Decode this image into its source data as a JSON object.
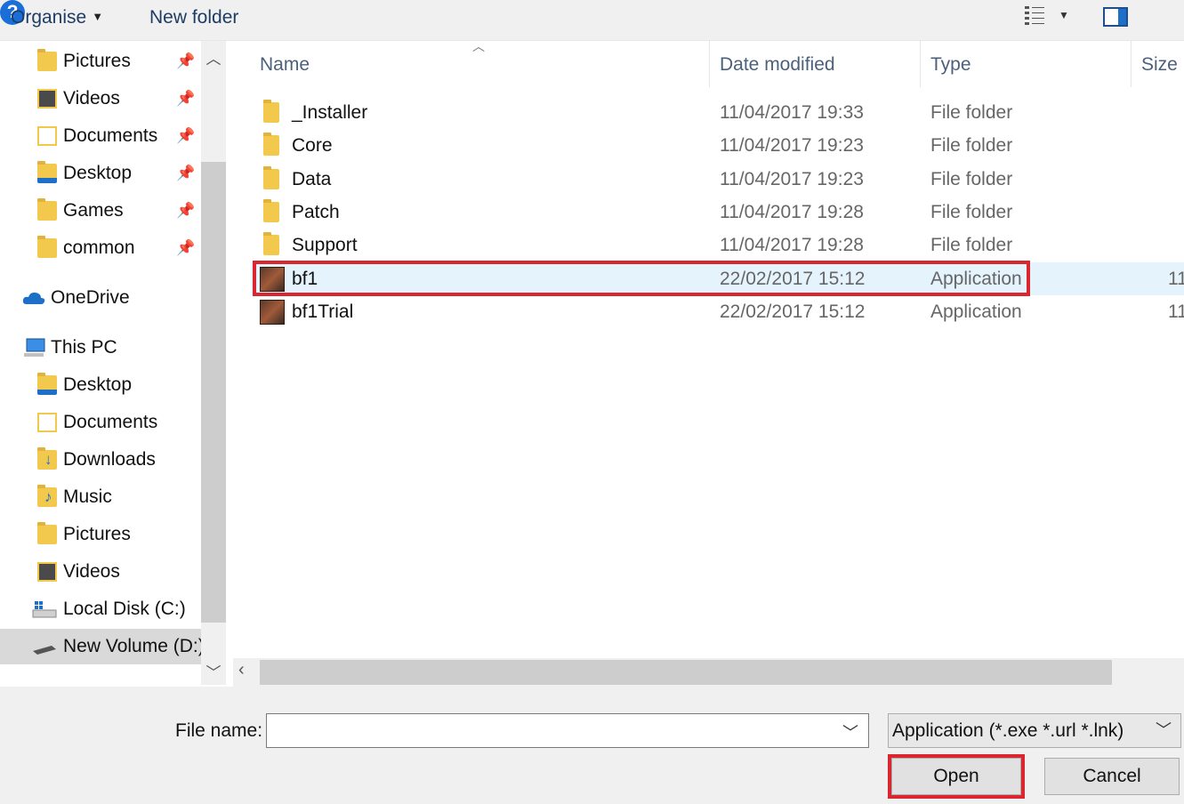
{
  "toolbar": {
    "organise_label": "Organise",
    "new_folder_label": "New folder",
    "help_label": "?"
  },
  "nav": {
    "quick_access": [
      {
        "label": "Pictures",
        "icon": "pictures-folder-icon",
        "pinned": true
      },
      {
        "label": "Videos",
        "icon": "videos-folder-icon",
        "pinned": true
      },
      {
        "label": "Documents",
        "icon": "documents-folder-icon",
        "pinned": true
      },
      {
        "label": "Desktop",
        "icon": "desktop-folder-icon",
        "pinned": true
      },
      {
        "label": "Games",
        "icon": "folder-icon",
        "pinned": true
      },
      {
        "label": "common",
        "icon": "folder-icon",
        "pinned": true
      }
    ],
    "onedrive_label": "OneDrive",
    "this_pc_label": "This PC",
    "this_pc_items": [
      {
        "label": "Desktop",
        "icon": "desktop-folder-icon"
      },
      {
        "label": "Documents",
        "icon": "documents-folder-icon"
      },
      {
        "label": "Downloads",
        "icon": "downloads-folder-icon"
      },
      {
        "label": "Music",
        "icon": "music-folder-icon"
      },
      {
        "label": "Pictures",
        "icon": "pictures-folder-icon"
      },
      {
        "label": "Videos",
        "icon": "videos-folder-icon"
      },
      {
        "label": "Local Disk (C:)",
        "icon": "local-disk-icon"
      },
      {
        "label": "New Volume (D:)",
        "icon": "drive-icon",
        "selected": true
      }
    ]
  },
  "list": {
    "columns": {
      "name": "Name",
      "date": "Date modified",
      "type": "Type",
      "size": "Size"
    },
    "rows": [
      {
        "name": "_Installer",
        "date": "11/04/2017 19:33",
        "type": "File folder",
        "size": "",
        "icon": "folder-icon"
      },
      {
        "name": "Core",
        "date": "11/04/2017 19:23",
        "type": "File folder",
        "size": "",
        "icon": "folder-icon"
      },
      {
        "name": "Data",
        "date": "11/04/2017 19:23",
        "type": "File folder",
        "size": "",
        "icon": "folder-icon"
      },
      {
        "name": "Patch",
        "date": "11/04/2017 19:28",
        "type": "File folder",
        "size": "",
        "icon": "folder-icon"
      },
      {
        "name": "Support",
        "date": "11/04/2017 19:28",
        "type": "File folder",
        "size": "",
        "icon": "folder-icon"
      },
      {
        "name": "bf1",
        "date": "22/02/2017 15:12",
        "type": "Application",
        "size": "11",
        "icon": "application-icon",
        "selected": true
      },
      {
        "name": "bf1Trial",
        "date": "22/02/2017 15:12",
        "type": "Application",
        "size": "11",
        "icon": "application-icon"
      }
    ]
  },
  "footer": {
    "file_name_label": "File name:",
    "file_name_value": "",
    "file_type_value": "Application (*.exe *.url *.lnk)",
    "open_label": "Open",
    "cancel_label": "Cancel"
  },
  "colors": {
    "highlight": "#d9262f",
    "selection": "#e5f3fd",
    "folder": "#f2c94c",
    "accent": "#1a6ed8"
  }
}
